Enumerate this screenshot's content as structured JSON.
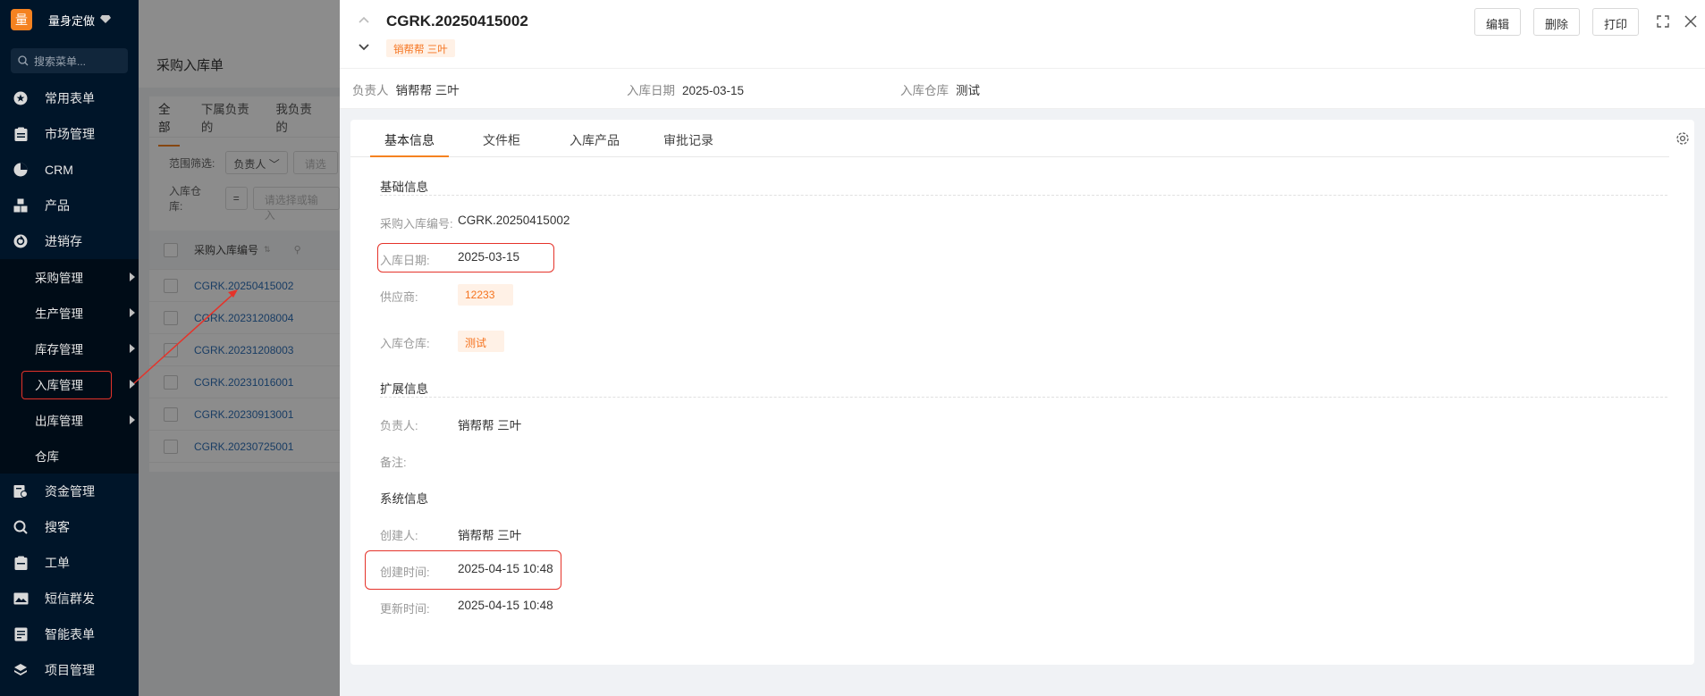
{
  "sidebar": {
    "brand_logo": "量",
    "brand_name": "量身定做",
    "search_placeholder": "搜索菜单...",
    "items": [
      {
        "label": "常用表单",
        "icon": "star-icon"
      },
      {
        "label": "市场管理",
        "icon": "clipboard-icon"
      },
      {
        "label": "CRM",
        "icon": "pie-icon"
      },
      {
        "label": "产品",
        "icon": "boxes-icon"
      },
      {
        "label": "进销存",
        "icon": "cycle-icon"
      }
    ],
    "sub_items": [
      "采购管理",
      "生产管理",
      "库存管理",
      "入库管理",
      "出库管理",
      "仓库"
    ],
    "items_after": [
      {
        "label": "资金管理",
        "icon": "money-icon"
      },
      {
        "label": "搜客",
        "icon": "search-icon"
      },
      {
        "label": "工单",
        "icon": "clipboard-icon"
      },
      {
        "label": "短信群发",
        "icon": "image-icon"
      },
      {
        "label": "智能表单",
        "icon": "form-icon"
      },
      {
        "label": "项目管理",
        "icon": "layers-icon"
      }
    ]
  },
  "list_page": {
    "title": "采购入库单",
    "tabs": [
      "全部",
      "下属负责的",
      "我负责的"
    ],
    "filter_label": "范围筛选:",
    "filter_select": "负责人",
    "filter_placeholder": "请选",
    "warehouse_label": "入库仓库:",
    "warehouse_op": "=",
    "warehouse_placeholder": "请选择或输入",
    "column_header": "采购入库编号",
    "rows": [
      "CGRK.20250415002",
      "CGRK.20231208004",
      "CGRK.20231208003",
      "CGRK.20231016001",
      "CGRK.20230913001",
      "CGRK.20230725001"
    ]
  },
  "drawer": {
    "title": "CGRK.20250415002",
    "owner_tag": "销帮帮 三叶",
    "buttons": {
      "edit": "编辑",
      "delete": "删除",
      "print": "打印"
    },
    "meta": [
      {
        "key": "负责人",
        "value": "销帮帮 三叶"
      },
      {
        "key": "入库日期",
        "value": "2025-03-15"
      },
      {
        "key": "入库仓库",
        "value": "测试"
      }
    ],
    "tabs": [
      "基本信息",
      "文件柜",
      "入库产品",
      "审批记录"
    ],
    "sections": {
      "basic_title": "基础信息",
      "ext_title": "扩展信息",
      "sys_title": "系统信息"
    },
    "fields": {
      "code_label": "采购入库编号:",
      "code_value": "CGRK.20250415002",
      "date_label": "入库日期:",
      "date_value": "2025-03-15",
      "supplier_label": "供应商:",
      "supplier_value": "12233",
      "warehouse_label": "入库仓库:",
      "warehouse_value": "测试",
      "owner_label": "负责人:",
      "owner_value": "销帮帮 三叶",
      "remark_label": "备注:",
      "creator_label": "创建人:",
      "creator_value": "销帮帮 三叶",
      "created_label": "创建时间:",
      "created_value": "2025-04-15 10:48",
      "updated_label": "更新时间:",
      "updated_value": "2025-04-15 10:48"
    }
  },
  "colors": {
    "sidebar": "#001529",
    "accent": "#f58220",
    "highlight": "#e5332a",
    "link": "#2f6fb6"
  }
}
